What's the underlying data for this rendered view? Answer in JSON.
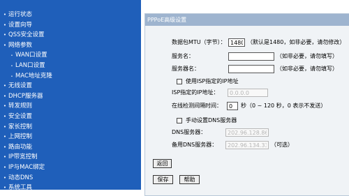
{
  "sidebar": {
    "items": [
      {
        "label": "运行状态",
        "sub": false
      },
      {
        "label": "设置向导",
        "sub": false
      },
      {
        "label": "QSS安全设置",
        "sub": false
      },
      {
        "label": "网络参数",
        "sub": false
      },
      {
        "label": "WAN口设置",
        "sub": true
      },
      {
        "label": "LAN口设置",
        "sub": true
      },
      {
        "label": "MAC地址克隆",
        "sub": true
      },
      {
        "label": "无线设置",
        "sub": false
      },
      {
        "label": "DHCP服务器",
        "sub": false
      },
      {
        "label": "转发规则",
        "sub": false
      },
      {
        "label": "安全设置",
        "sub": false
      },
      {
        "label": "家长控制",
        "sub": false
      },
      {
        "label": "上网控制",
        "sub": false
      },
      {
        "label": "路由功能",
        "sub": false
      },
      {
        "label": "IP带宽控制",
        "sub": false
      },
      {
        "label": "IP与MAC绑定",
        "sub": false
      },
      {
        "label": "动态DNS",
        "sub": false
      },
      {
        "label": "系统工具",
        "sub": false
      }
    ]
  },
  "panel": {
    "title": "PPPoE高级设置",
    "mtu": {
      "label": "数据包MTU（字节）：",
      "value": "1480",
      "hint": "（默认是1480，如非必要，请勿修改）"
    },
    "service_name": {
      "label": "服务名：",
      "value": "",
      "hint": "（如非必要，请勿填写）"
    },
    "server_name": {
      "label": "服务器名：",
      "value": "",
      "hint": "（如非必要，请勿填写）"
    },
    "isp_ip": {
      "checkbox_label": "使用ISP指定的IP地址",
      "label": "ISP指定的IP地址：",
      "value": "0.0.0.0"
    },
    "interval": {
      "label": "在线检测间隔时间：",
      "value": "0",
      "hint": "秒（0 ~ 120 秒，0 表示不发送）"
    },
    "dns": {
      "checkbox_label": "手动设置DNS服务器",
      "primary_label": "DNS服务器：",
      "primary_value": "202.96.128.86",
      "secondary_label": "备用DNS服务器：",
      "secondary_value": "202.96.134.33",
      "secondary_hint": "（可选）"
    },
    "back_button": "返回",
    "save_button": "保存",
    "help_button": "帮助"
  }
}
